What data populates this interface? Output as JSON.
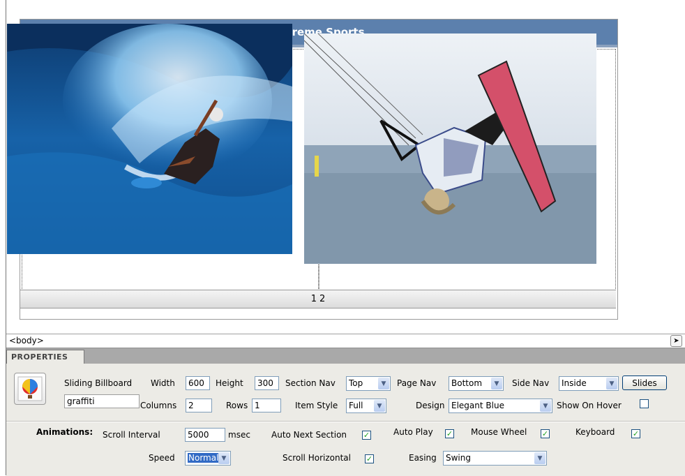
{
  "billboard": {
    "title": "Extreme Sports",
    "pages": [
      "1",
      "2"
    ]
  },
  "tag_selector": {
    "tag": "<body>"
  },
  "properties": {
    "tab_label": "PROPERTIES",
    "widget_name": "Sliding Billboard",
    "instance_name": "graffiti",
    "width_label": "Width",
    "width_value": "600",
    "height_label": "Height",
    "height_value": "300",
    "section_nav_label": "Section Nav",
    "section_nav_value": "Top",
    "page_nav_label": "Page Nav",
    "page_nav_value": "Bottom",
    "side_nav_label": "Side Nav",
    "side_nav_value": "Inside",
    "slides_button": "Slides",
    "columns_label": "Columns",
    "columns_value": "2",
    "rows_label": "Rows",
    "rows_value": "1",
    "item_style_label": "Item Style",
    "item_style_value": "Full",
    "design_label": "Design",
    "design_value": "Elegant Blue",
    "show_on_hover_label": "Show On Hover",
    "show_on_hover_checked": false
  },
  "animations": {
    "heading": "Animations:",
    "scroll_interval_label": "Scroll Interval",
    "scroll_interval_value": "5000",
    "scroll_interval_unit": "msec",
    "auto_next_section_label": "Auto Next Section",
    "auto_next_section_checked": true,
    "auto_play_label": "Auto Play",
    "auto_play_checked": true,
    "mouse_wheel_label": "Mouse Wheel",
    "mouse_wheel_checked": true,
    "keyboard_label": "Keyboard",
    "keyboard_checked": true,
    "speed_label": "Speed",
    "speed_value": "Normal",
    "scroll_horizontal_label": "Scroll Horizontal",
    "scroll_horizontal_checked": true,
    "easing_label": "Easing",
    "easing_value": "Swing"
  },
  "colors": {
    "header_blue": "#5c80ad",
    "panel_bg": "#ecebe6",
    "selection_blue": "#316ac5",
    "check_green": "#21a121"
  }
}
